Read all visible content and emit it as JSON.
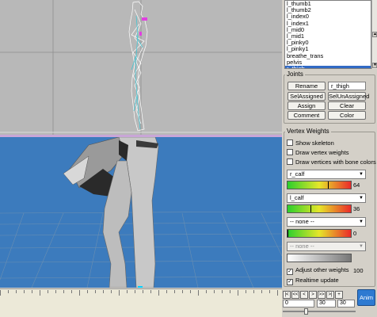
{
  "bones_list": {
    "items": [
      "l_thumb1",
      "l_thumb2",
      "l_index0",
      "l_index1",
      "l_mid0",
      "l_mid1",
      "l_pinky0",
      "l_pinky1",
      "breathe_trans",
      "pelvis",
      "r_thigh"
    ],
    "selected": "r_thigh"
  },
  "joints": {
    "title": "Joints",
    "rename": "Rename",
    "name_value": "r_thigh",
    "sel_assigned": "SelAssigned",
    "sel_unassigned": "SelUnAssigned",
    "assign": "Assign",
    "clear": "Clear",
    "comment": "Comment",
    "color": "Color"
  },
  "vertex_weights": {
    "title": "Vertex Weights",
    "show_skeleton": "Show skeleton",
    "draw_vertex_weights": "Draw vertex weights",
    "draw_vertices_bone_colors": "Draw vertices with bone colors",
    "slots": [
      {
        "bone": "r_calf",
        "value": "64",
        "fraction": 0.64
      },
      {
        "bone": "l_calf",
        "value": "36",
        "fraction": 0.36
      },
      {
        "bone": "-- none --",
        "value": "0",
        "fraction": 0
      }
    ],
    "slot4_bone": "-- none --",
    "adjust_other_weights": "Adjust other weights",
    "adjust_value": "100",
    "realtime_update": "Realtime update"
  },
  "timeline": {
    "anim_label": "Anim",
    "start_frame": "0",
    "current_frame": "30",
    "end_frame": "30",
    "buttons": [
      "|<",
      "<<",
      "<",
      ">",
      ">>",
      ">|",
      "+"
    ]
  },
  "colors": {
    "viewport_top": "#b8b8b8",
    "viewport_bottom": "#3c7bbd",
    "selection": "#316ac5",
    "anim_button": "#2e7ad1"
  }
}
